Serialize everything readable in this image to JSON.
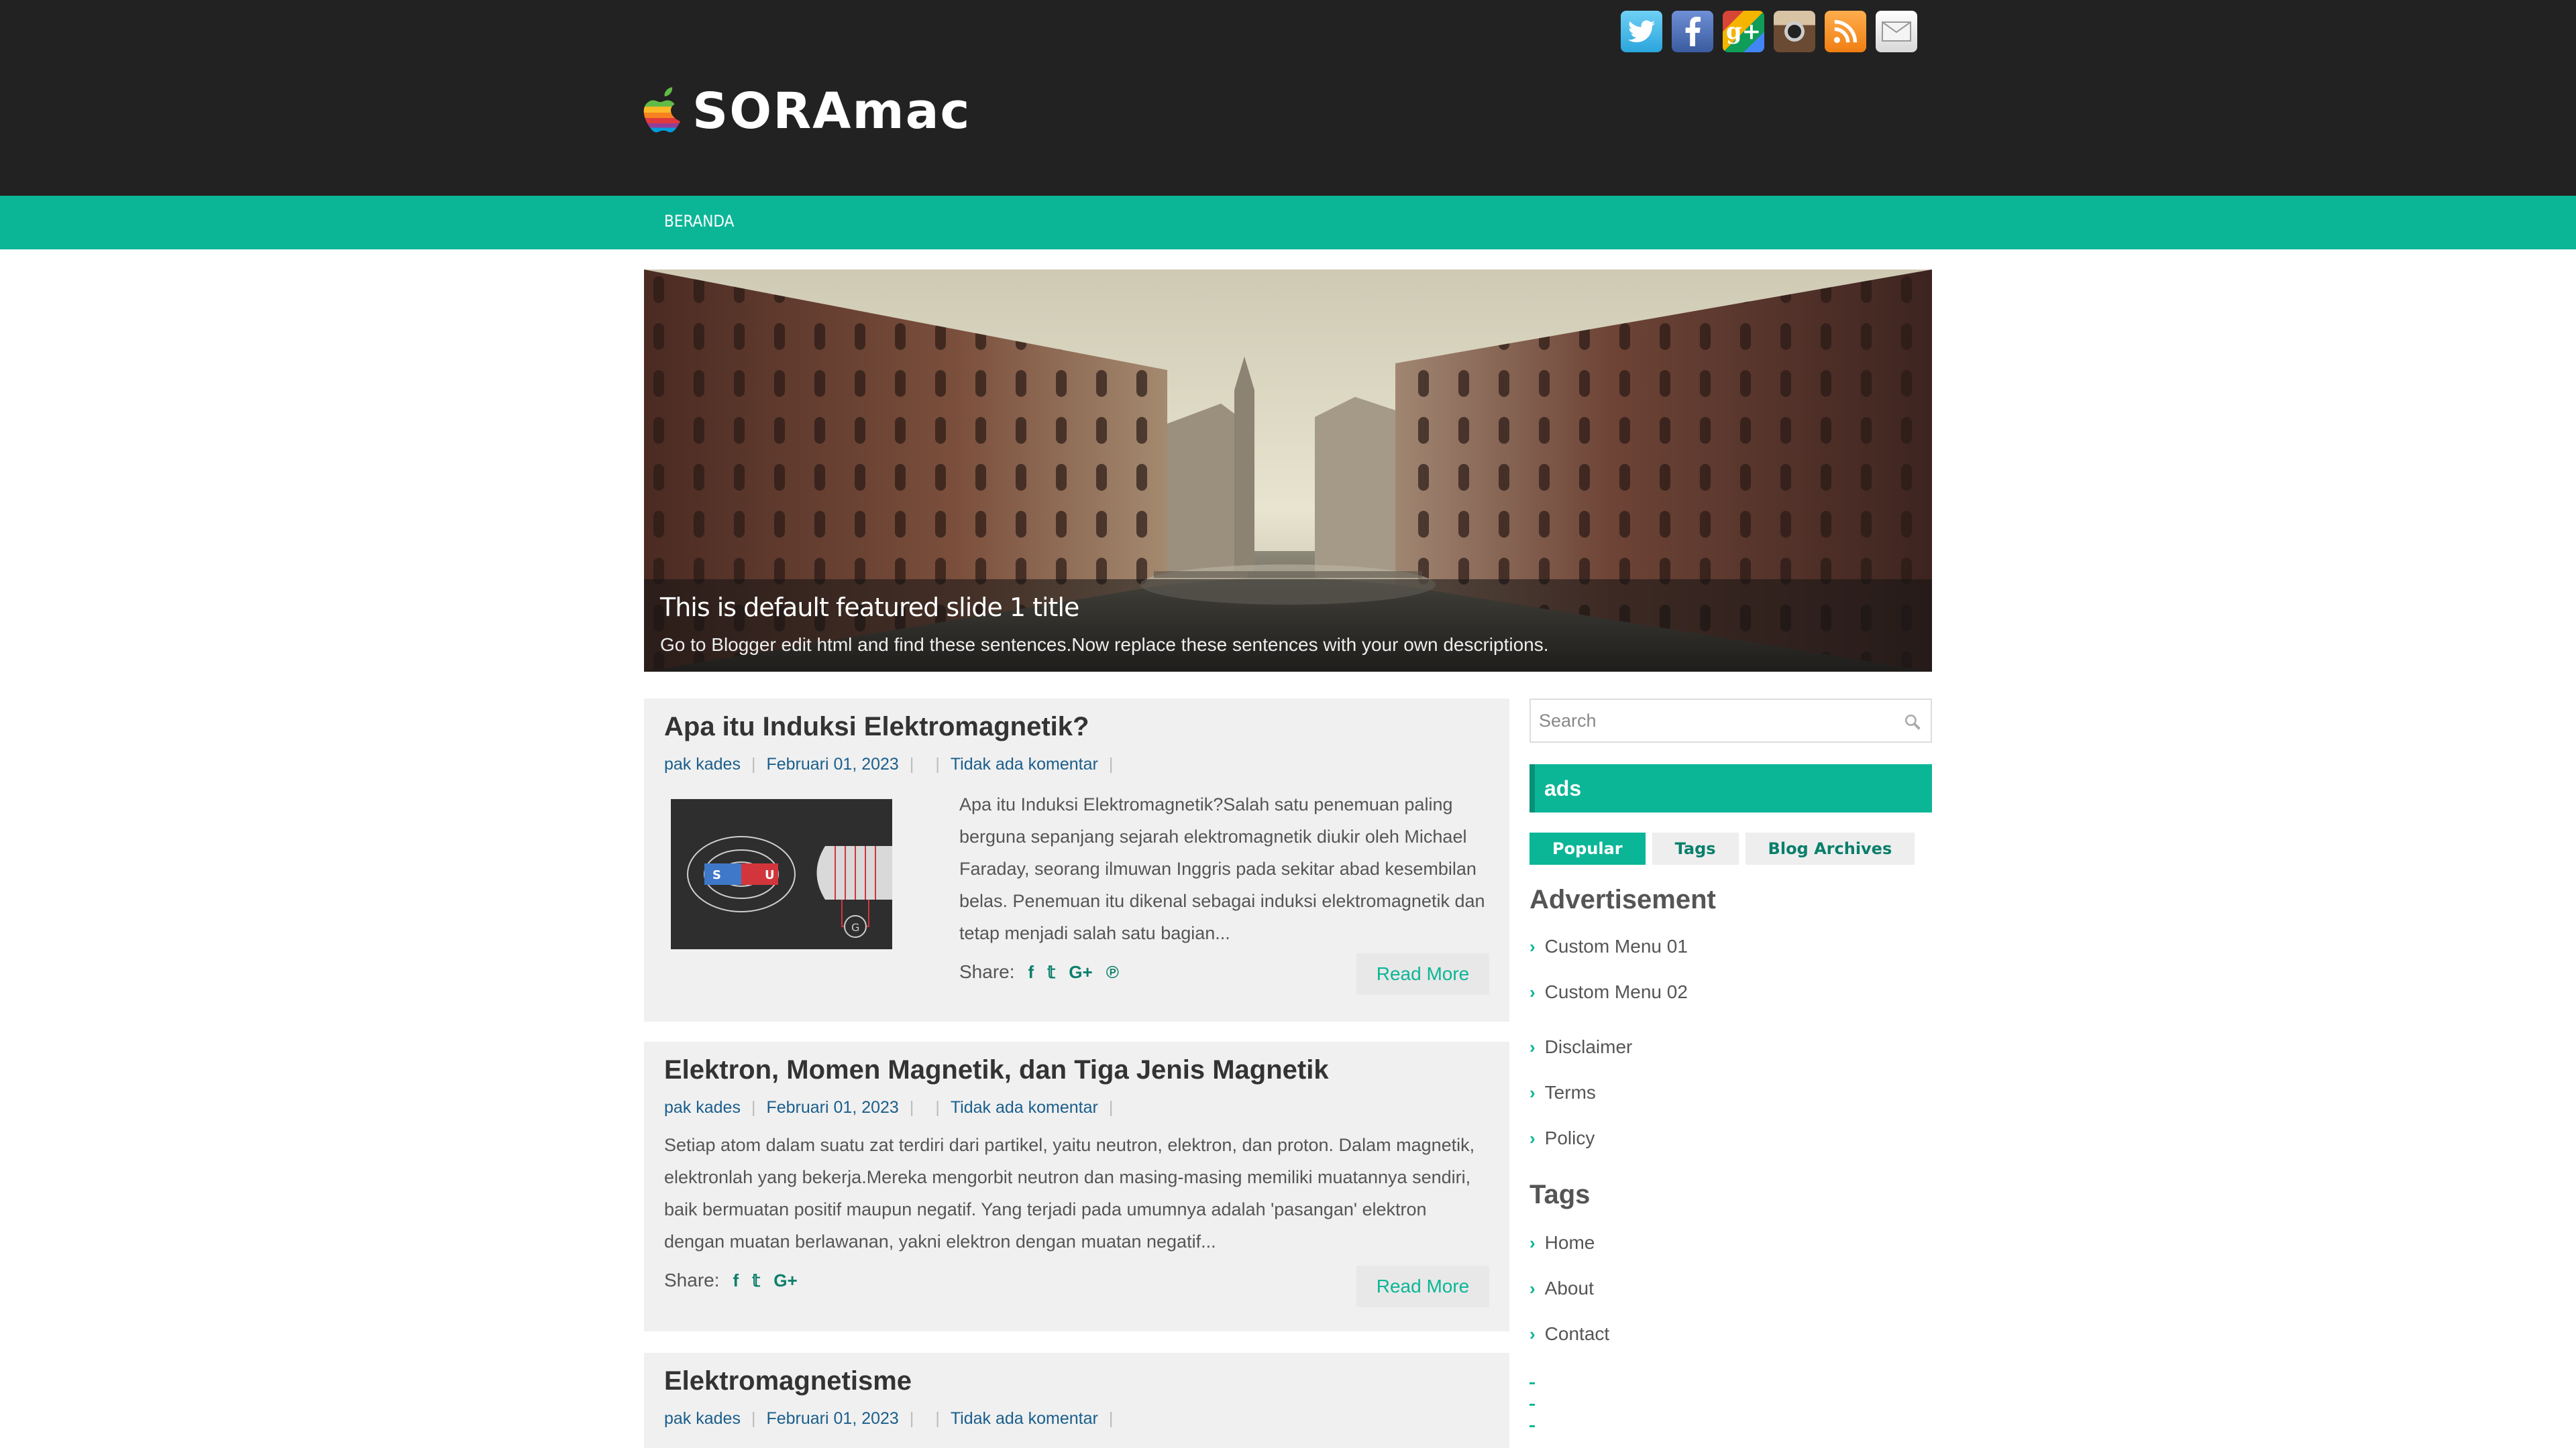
{
  "header": {
    "logo_text": "SORAmac",
    "social_icons": [
      "twitter-icon",
      "facebook-icon",
      "google-plus-icon",
      "instagram-icon",
      "rss-icon",
      "mail-icon"
    ]
  },
  "nav": {
    "items": [
      "BERANDA"
    ]
  },
  "slider": {
    "title": "This is default featured slide 1 title",
    "description": "Go to Blogger edit html and find these sentences.Now replace these sentences with your own descriptions."
  },
  "posts": [
    {
      "title": "Apa itu Induksi Elektromagnetik?",
      "author": "pak kades",
      "date": "Februari 01, 2023",
      "comments": "Tidak ada komentar",
      "excerpt": "Apa itu Induksi Elektromagnetik?Salah satu penemuan paling berguna sepanjang sejarah elektromagnetik diukir oleh Michael Faraday, seorang ilmuwan Inggris pada sekitar abad kesembilan belas. Penemuan itu dikenal sebagai induksi elektromagnetik dan tetap menjadi salah satu bagian...",
      "share_label": "Share:",
      "read_more": "Read More",
      "thumb_labels": {
        "s": "S",
        "u": "U",
        "g": "G"
      }
    },
    {
      "title": "Elektron, Momen Magnetik, dan Tiga Jenis Magnetik",
      "author": "pak kades",
      "date": "Februari 01, 2023",
      "comments": "Tidak ada komentar",
      "excerpt": "Setiap atom dalam suatu zat terdiri dari partikel, yaitu neutron, elektron, dan proton. Dalam magnetik, elektronlah yang bekerja.Mereka mengorbit neutron dan masing-masing memiliki muatannya sendiri, baik bermuatan positif maupun negatif. Yang terjadi pada umumnya adalah 'pasangan' elektron dengan muatan berlawanan, yakni elektron dengan muatan negatif...",
      "share_label": "Share:",
      "read_more": "Read More"
    },
    {
      "title": "Elektromagnetisme",
      "author": "pak kades",
      "date": "Februari 01, 2023",
      "comments": "Tidak ada komentar"
    }
  ],
  "sidebar": {
    "search_placeholder": "Search",
    "ads_title": "ads",
    "tabs": [
      "Popular",
      "Tags",
      "Blog Archives"
    ],
    "advertisement_title": "Advertisement",
    "advertisement_links": [
      "Custom Menu 01",
      "Custom Menu 02"
    ],
    "page_links": [
      "Disclaimer",
      "Terms",
      "Policy"
    ],
    "tags_title": "Tags",
    "tags_links": [
      "Home",
      "About",
      "Contact"
    ]
  },
  "colors": {
    "accent": "#0bb697",
    "header_bg": "#222222",
    "link": "#1a5e8c"
  }
}
